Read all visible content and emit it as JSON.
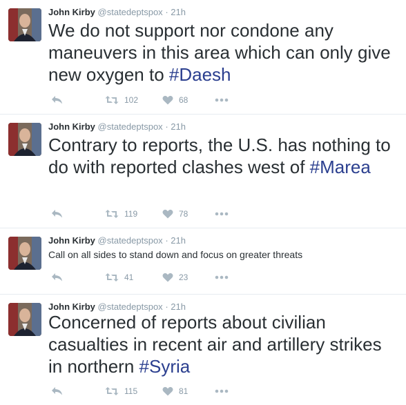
{
  "tweets": [
    {
      "name": "John Kirby",
      "handle": "@statedeptspox",
      "sep": "·",
      "time": "21h",
      "text_plain": "We do not support nor condone any maneuvers in this area which can only give new oxygen to ",
      "hashtag": "#Daesh",
      "retweets": "102",
      "likes": "68"
    },
    {
      "name": "John Kirby",
      "handle": "@statedeptspox",
      "sep": "·",
      "time": "21h",
      "text_plain": "Contrary to reports, the U.S. has nothing to do with reported clashes west of ",
      "hashtag": "#Marea",
      "retweets": "119",
      "likes": "78"
    },
    {
      "name": "John Kirby",
      "handle": "@statedeptspox",
      "sep": "·",
      "time": "21h",
      "text_plain": "Call on all sides to stand down and focus on greater threats",
      "hashtag": "",
      "retweets": "41",
      "likes": "23"
    },
    {
      "name": "John Kirby",
      "handle": "@statedeptspox",
      "sep": "·",
      "time": "21h",
      "text_plain": "Concerned of reports about civilian casualties in recent air and artillery strikes in northern ",
      "hashtag": "#Syria",
      "retweets": "115",
      "likes": "81"
    }
  ],
  "icons": {
    "reply": "reply-icon",
    "retweet": "retweet-icon",
    "like": "heart-icon",
    "more": "more-dots-icon"
  },
  "colors": {
    "hashtag": "#2b3f8f",
    "meta": "#8899a6",
    "divider": "#e6ecf0"
  }
}
